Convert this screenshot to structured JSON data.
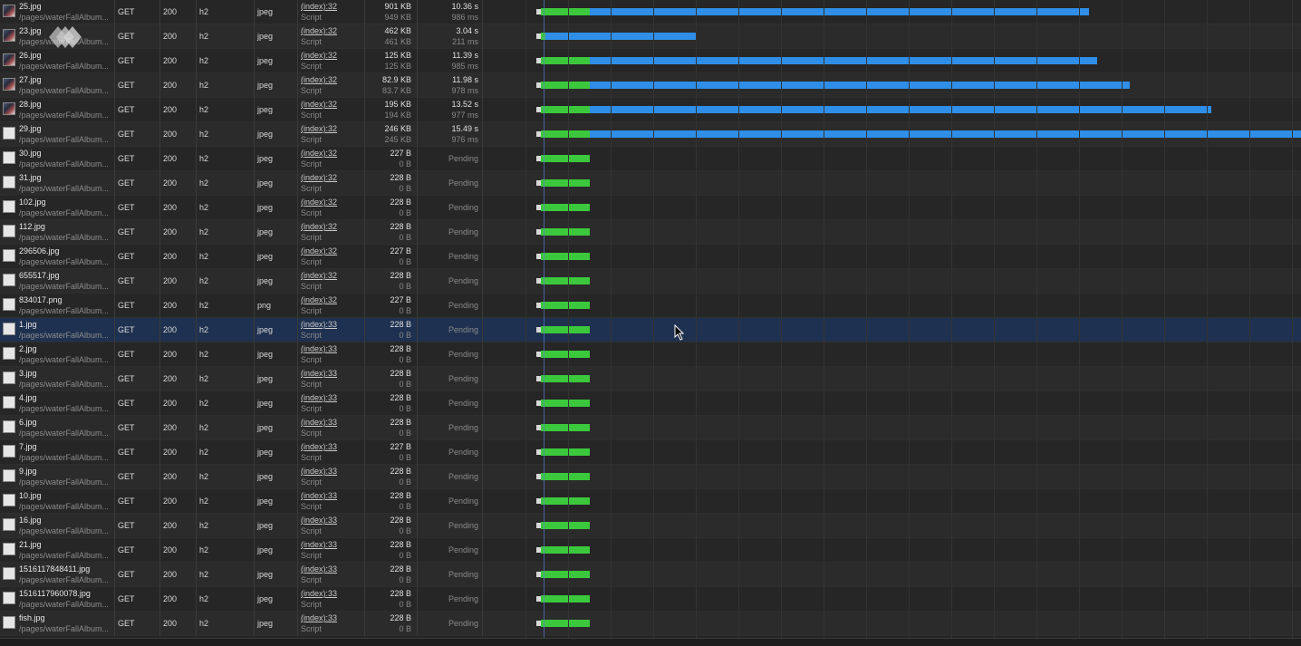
{
  "requests": [
    {
      "name": "25.jpg",
      "path": "/pages/waterFallAlbum...",
      "method": "GET",
      "status": "200",
      "protocol": "h2",
      "type": "jpeg",
      "initiator": "(index):32",
      "initiator_type": "Script",
      "size": "901 KB",
      "resource": "949 KB",
      "time": "10.36 s",
      "latency": "986 ms",
      "waterfall": {
        "wait": 0.06,
        "download": 0.67
      },
      "thumb": "photo"
    },
    {
      "name": "23.jpg",
      "path": "/pages/waterFallAlbum...",
      "method": "GET",
      "status": "200",
      "protocol": "h2",
      "type": "jpeg",
      "initiator": "(index):32",
      "initiator_type": "Script",
      "size": "462 KB",
      "resource": "461 KB",
      "time": "3.04 s",
      "latency": "211 ms",
      "waterfall": {
        "wait": 0.006,
        "download": 0.19
      },
      "thumb": "photo"
    },
    {
      "name": "26.jpg",
      "path": "/pages/waterFallAlbum...",
      "method": "GET",
      "status": "200",
      "protocol": "h2",
      "type": "jpeg",
      "initiator": "(index):32",
      "initiator_type": "Script",
      "size": "125 KB",
      "resource": "125 KB",
      "time": "11.39 s",
      "latency": "985 ms",
      "waterfall": {
        "wait": 0.06,
        "download": 0.68
      },
      "thumb": "photo"
    },
    {
      "name": "27.jpg",
      "path": "/pages/waterFallAlbum...",
      "method": "GET",
      "status": "200",
      "protocol": "h2",
      "type": "jpeg",
      "initiator": "(index):32",
      "initiator_type": "Script",
      "size": "82.9 KB",
      "resource": "83.7 KB",
      "time": "11.98 s",
      "latency": "978 ms",
      "waterfall": {
        "wait": 0.06,
        "download": 0.72
      },
      "thumb": "photo"
    },
    {
      "name": "28.jpg",
      "path": "/pages/waterFallAlbum...",
      "method": "GET",
      "status": "200",
      "protocol": "h2",
      "type": "jpeg",
      "initiator": "(index):32",
      "initiator_type": "Script",
      "size": "195 KB",
      "resource": "194 KB",
      "time": "13.52 s",
      "latency": "977 ms",
      "waterfall": {
        "wait": 0.06,
        "download": 0.82
      },
      "thumb": "photo"
    },
    {
      "name": "29.jpg",
      "path": "/pages/waterFallAlbum...",
      "method": "GET",
      "status": "200",
      "protocol": "h2",
      "type": "jpeg",
      "initiator": "(index):32",
      "initiator_type": "Script",
      "size": "246 KB",
      "resource": "245 KB",
      "time": "15.49 s",
      "latency": "976 ms",
      "waterfall": {
        "wait": 0.06,
        "download": 0.93
      },
      "thumb": "blank"
    },
    {
      "name": "30.jpg",
      "path": "/pages/waterFallAlbum...",
      "method": "GET",
      "status": "200",
      "protocol": "h2",
      "type": "jpeg",
      "initiator": "(index):32",
      "initiator_type": "Script",
      "size": "227 B",
      "resource": "0 B",
      "time": "Pending",
      "latency": "",
      "waterfall": {
        "wait": 0.06,
        "download": 0
      },
      "thumb": "blank"
    },
    {
      "name": "31.jpg",
      "path": "/pages/waterFallAlbum...",
      "method": "GET",
      "status": "200",
      "protocol": "h2",
      "type": "jpeg",
      "initiator": "(index):32",
      "initiator_type": "Script",
      "size": "228 B",
      "resource": "0 B",
      "time": "Pending",
      "latency": "",
      "waterfall": {
        "wait": 0.06,
        "download": 0
      },
      "thumb": "blank"
    },
    {
      "name": "102.jpg",
      "path": "/pages/waterFallAlbum...",
      "method": "GET",
      "status": "200",
      "protocol": "h2",
      "type": "jpeg",
      "initiator": "(index):32",
      "initiator_type": "Script",
      "size": "228 B",
      "resource": "0 B",
      "time": "Pending",
      "latency": "",
      "waterfall": {
        "wait": 0.06,
        "download": 0
      },
      "thumb": "blank"
    },
    {
      "name": "112.jpg",
      "path": "/pages/waterFallAlbum...",
      "method": "GET",
      "status": "200",
      "protocol": "h2",
      "type": "jpeg",
      "initiator": "(index):32",
      "initiator_type": "Script",
      "size": "228 B",
      "resource": "0 B",
      "time": "Pending",
      "latency": "",
      "waterfall": {
        "wait": 0.06,
        "download": 0
      },
      "thumb": "blank"
    },
    {
      "name": "296506.jpg",
      "path": "/pages/waterFallAlbum...",
      "method": "GET",
      "status": "200",
      "protocol": "h2",
      "type": "jpeg",
      "initiator": "(index):32",
      "initiator_type": "Script",
      "size": "227 B",
      "resource": "0 B",
      "time": "Pending",
      "latency": "",
      "waterfall": {
        "wait": 0.06,
        "download": 0
      },
      "thumb": "blank"
    },
    {
      "name": "655517.jpg",
      "path": "/pages/waterFallAlbum...",
      "method": "GET",
      "status": "200",
      "protocol": "h2",
      "type": "jpeg",
      "initiator": "(index):32",
      "initiator_type": "Script",
      "size": "228 B",
      "resource": "0 B",
      "time": "Pending",
      "latency": "",
      "waterfall": {
        "wait": 0.06,
        "download": 0
      },
      "thumb": "blank"
    },
    {
      "name": "834017.png",
      "path": "/pages/waterFallAlbum...",
      "method": "GET",
      "status": "200",
      "protocol": "h2",
      "type": "png",
      "initiator": "(index):32",
      "initiator_type": "Script",
      "size": "227 B",
      "resource": "0 B",
      "time": "Pending",
      "latency": "",
      "waterfall": {
        "wait": 0.06,
        "download": 0
      },
      "thumb": "blank"
    },
    {
      "name": "1.jpg",
      "path": "/pages/waterFallAlbum...",
      "method": "GET",
      "status": "200",
      "protocol": "h2",
      "type": "jpeg",
      "initiator": "(index):33",
      "initiator_type": "Script",
      "size": "228 B",
      "resource": "0 B",
      "time": "Pending",
      "latency": "",
      "waterfall": {
        "wait": 0.06,
        "download": 0
      },
      "thumb": "blank",
      "selected": true
    },
    {
      "name": "2.jpg",
      "path": "/pages/waterFallAlbum...",
      "method": "GET",
      "status": "200",
      "protocol": "h2",
      "type": "jpeg",
      "initiator": "(index):33",
      "initiator_type": "Script",
      "size": "228 B",
      "resource": "0 B",
      "time": "Pending",
      "latency": "",
      "waterfall": {
        "wait": 0.06,
        "download": 0
      },
      "thumb": "blank"
    },
    {
      "name": "3.jpg",
      "path": "/pages/waterFallAlbum...",
      "method": "GET",
      "status": "200",
      "protocol": "h2",
      "type": "jpeg",
      "initiator": "(index):33",
      "initiator_type": "Script",
      "size": "228 B",
      "resource": "0 B",
      "time": "Pending",
      "latency": "",
      "waterfall": {
        "wait": 0.06,
        "download": 0
      },
      "thumb": "blank"
    },
    {
      "name": "4.jpg",
      "path": "/pages/waterFallAlbum...",
      "method": "GET",
      "status": "200",
      "protocol": "h2",
      "type": "jpeg",
      "initiator": "(index):33",
      "initiator_type": "Script",
      "size": "228 B",
      "resource": "0 B",
      "time": "Pending",
      "latency": "",
      "waterfall": {
        "wait": 0.06,
        "download": 0
      },
      "thumb": "blank"
    },
    {
      "name": "6.jpg",
      "path": "/pages/waterFallAlbum...",
      "method": "GET",
      "status": "200",
      "protocol": "h2",
      "type": "jpeg",
      "initiator": "(index):33",
      "initiator_type": "Script",
      "size": "228 B",
      "resource": "0 B",
      "time": "Pending",
      "latency": "",
      "waterfall": {
        "wait": 0.06,
        "download": 0
      },
      "thumb": "blank"
    },
    {
      "name": "7.jpg",
      "path": "/pages/waterFallAlbum...",
      "method": "GET",
      "status": "200",
      "protocol": "h2",
      "type": "jpeg",
      "initiator": "(index):33",
      "initiator_type": "Script",
      "size": "227 B",
      "resource": "0 B",
      "time": "Pending",
      "latency": "",
      "waterfall": {
        "wait": 0.06,
        "download": 0
      },
      "thumb": "blank"
    },
    {
      "name": "9.jpg",
      "path": "/pages/waterFallAlbum...",
      "method": "GET",
      "status": "200",
      "protocol": "h2",
      "type": "jpeg",
      "initiator": "(index):33",
      "initiator_type": "Script",
      "size": "228 B",
      "resource": "0 B",
      "time": "Pending",
      "latency": "",
      "waterfall": {
        "wait": 0.06,
        "download": 0
      },
      "thumb": "blank"
    },
    {
      "name": "10.jpg",
      "path": "/pages/waterFallAlbum...",
      "method": "GET",
      "status": "200",
      "protocol": "h2",
      "type": "jpeg",
      "initiator": "(index):33",
      "initiator_type": "Script",
      "size": "228 B",
      "resource": "0 B",
      "time": "Pending",
      "latency": "",
      "waterfall": {
        "wait": 0.06,
        "download": 0
      },
      "thumb": "blank"
    },
    {
      "name": "16.jpg",
      "path": "/pages/waterFallAlbum...",
      "method": "GET",
      "status": "200",
      "protocol": "h2",
      "type": "jpeg",
      "initiator": "(index):33",
      "initiator_type": "Script",
      "size": "228 B",
      "resource": "0 B",
      "time": "Pending",
      "latency": "",
      "waterfall": {
        "wait": 0.06,
        "download": 0
      },
      "thumb": "blank"
    },
    {
      "name": "21.jpg",
      "path": "/pages/waterFallAlbum...",
      "method": "GET",
      "status": "200",
      "protocol": "h2",
      "type": "jpeg",
      "initiator": "(index):33",
      "initiator_type": "Script",
      "size": "228 B",
      "resource": "0 B",
      "time": "Pending",
      "latency": "",
      "waterfall": {
        "wait": 0.06,
        "download": 0
      },
      "thumb": "blank"
    },
    {
      "name": "1516117848411.jpg",
      "path": "/pages/waterFallAlbum...",
      "method": "GET",
      "status": "200",
      "protocol": "h2",
      "type": "jpeg",
      "initiator": "(index):33",
      "initiator_type": "Script",
      "size": "228 B",
      "resource": "0 B",
      "time": "Pending",
      "latency": "",
      "waterfall": {
        "wait": 0.06,
        "download": 0
      },
      "thumb": "blank"
    },
    {
      "name": "1516117960078.jpg",
      "path": "/pages/waterFallAlbum...",
      "method": "GET",
      "status": "200",
      "protocol": "h2",
      "type": "jpeg",
      "initiator": "(index):33",
      "initiator_type": "Script",
      "size": "228 B",
      "resource": "0 B",
      "time": "Pending",
      "latency": "",
      "waterfall": {
        "wait": 0.06,
        "download": 0
      },
      "thumb": "blank"
    },
    {
      "name": "fish.jpg",
      "path": "/pages/waterFallAlbum...",
      "method": "GET",
      "status": "200",
      "protocol": "h2",
      "type": "jpeg",
      "initiator": "(index):33",
      "initiator_type": "Script",
      "size": "228 B",
      "resource": "0 B",
      "time": "Pending",
      "latency": "",
      "waterfall": {
        "wait": 0.06,
        "download": 0
      },
      "thumb": "blank"
    }
  ],
  "colors": {
    "wait": "#3cc83c",
    "download": "#2e8ee8",
    "selected_row": "#1f3150",
    "marker_line": "#5a7ad0"
  }
}
